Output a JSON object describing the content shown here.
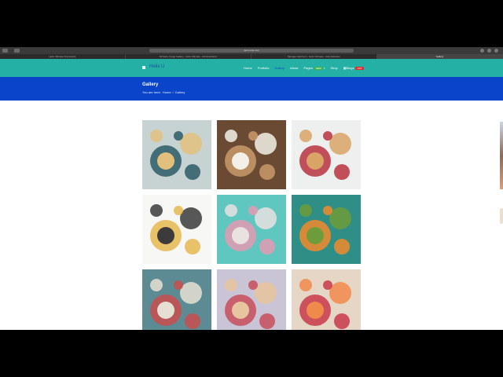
{
  "browser": {
    "address": "demo-site.com",
    "tabs": [
      {
        "label": "Helix Ultimate Framework",
        "active": false
      },
      {
        "label": "SP Easy Image Gallery - Helix Ultimate - Administration",
        "active": false
      },
      {
        "label": "Manage: Edit Item - Helix Ultimate - Administration",
        "active": false
      },
      {
        "label": "Gallery",
        "active": true
      }
    ]
  },
  "site": {
    "logo": "Helix U",
    "menu": [
      {
        "label": "Home",
        "current": false
      },
      {
        "label": "Portfolio",
        "current": false
      },
      {
        "label": "Gallery",
        "current": true
      },
      {
        "label": "About",
        "current": false
      },
      {
        "label": "Pages",
        "current": false,
        "badge": "NEW",
        "dropdown": true
      },
      {
        "label": "Shop",
        "current": false
      },
      {
        "label": "Blogs",
        "current": false,
        "badge": "HOT",
        "icon": "grid-icon"
      }
    ],
    "page_title": "Gallery",
    "breadcrumb": {
      "prefix": "You are here:",
      "items": [
        "Home",
        "/",
        "Gallery"
      ]
    }
  },
  "gallery": {
    "images": [
      {
        "name": "plate-with-pancakes",
        "colors": [
          "#c7d3d3",
          "#2c5a66",
          "#e2c07c"
        ]
      },
      {
        "name": "berry-bowl-on-board",
        "colors": [
          "#6b4a34",
          "#c99a6a",
          "#f2f0e8"
        ]
      },
      {
        "name": "lattice-pies",
        "colors": [
          "#eef0ef",
          "#b8323e",
          "#d9a566"
        ]
      },
      {
        "name": "breakfast-flatlay",
        "colors": [
          "#f7f7f5",
          "#e6b74f",
          "#3b3b3b"
        ]
      },
      {
        "name": "candy-bags",
        "colors": [
          "#5fc6c0",
          "#e49ab1",
          "#e8e2e0"
        ]
      },
      {
        "name": "fruit-cups",
        "colors": [
          "#2f8f86",
          "#f28a2d",
          "#6f9c3a"
        ]
      },
      {
        "name": "salad-plates",
        "colors": [
          "#5d8b94",
          "#c94d4d",
          "#e6e0d4"
        ]
      },
      {
        "name": "dessert-bowls-pink",
        "colors": [
          "#c9c4d6",
          "#c84d5b",
          "#e7c59e"
        ]
      },
      {
        "name": "citrus-dragonfruit",
        "colors": [
          "#e6d6c6",
          "#c8384a",
          "#f08a4a"
        ]
      }
    ]
  }
}
